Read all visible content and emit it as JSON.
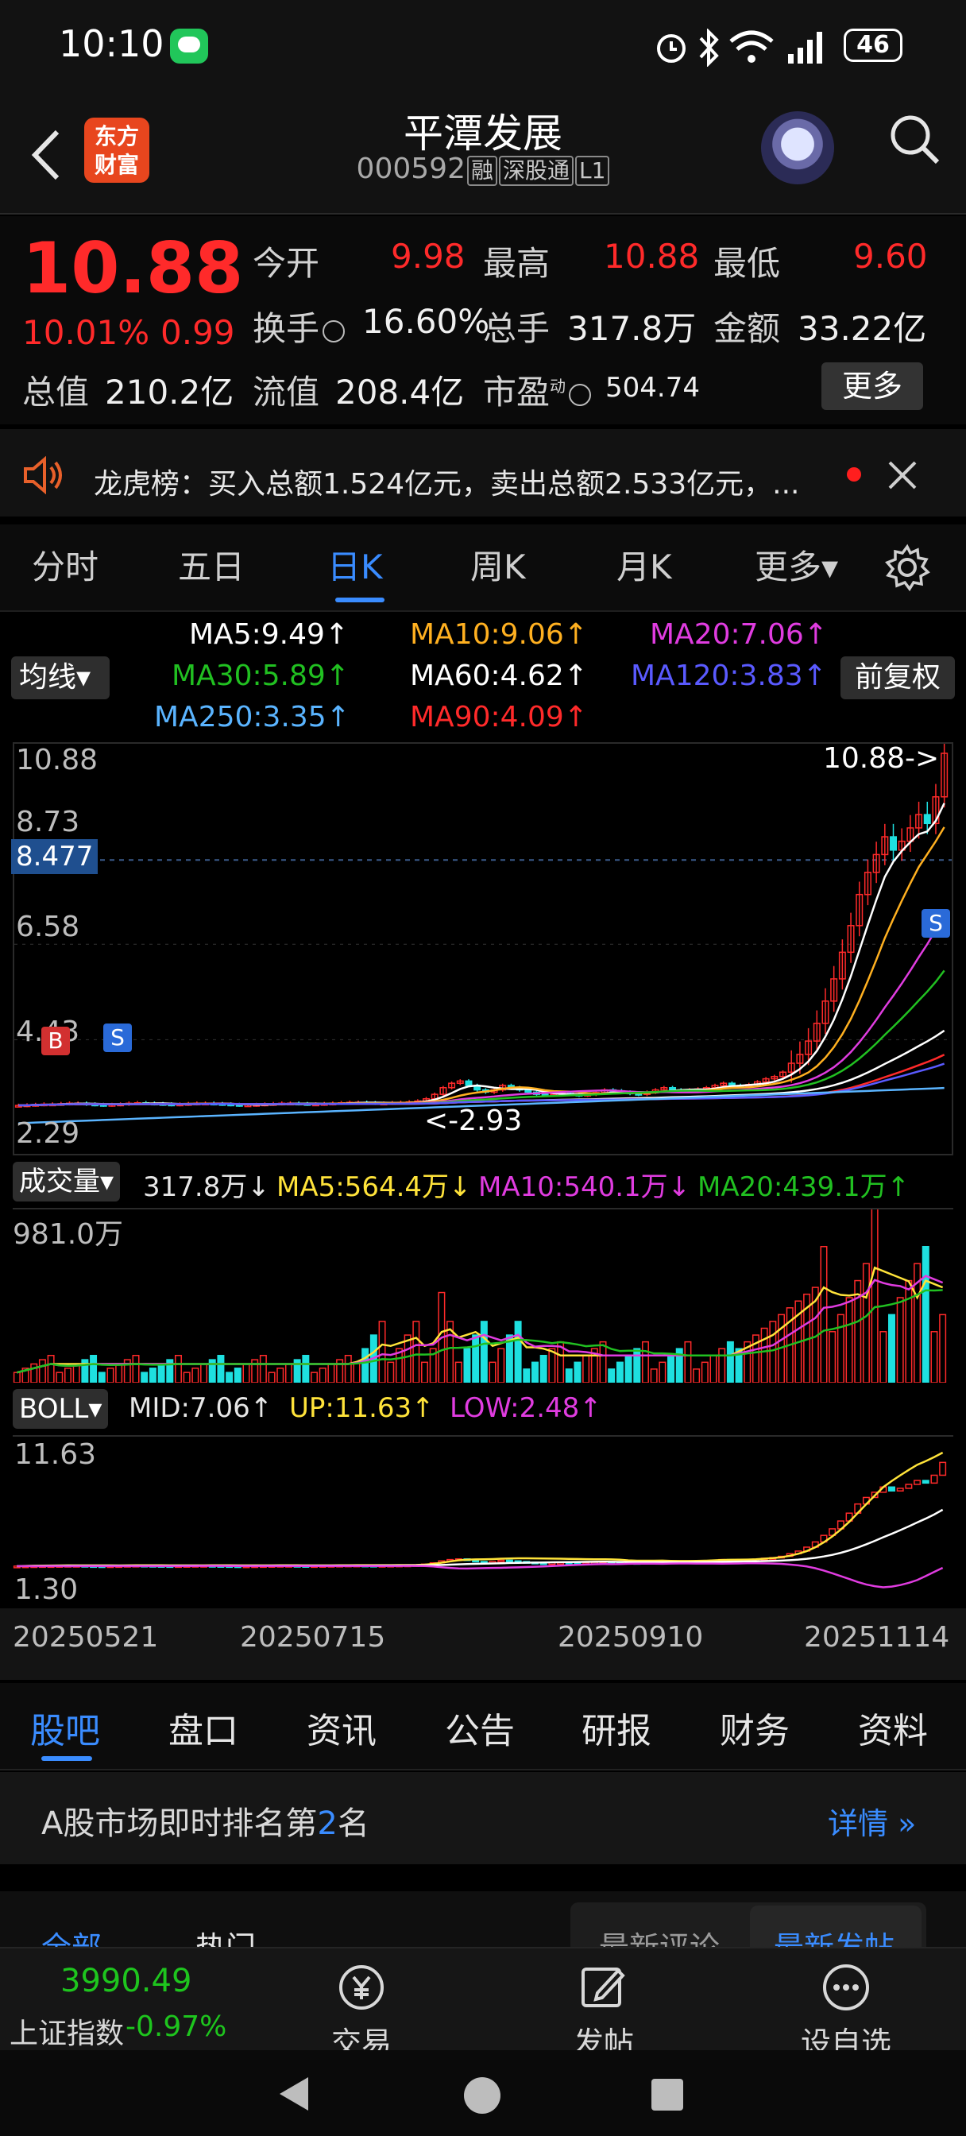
{
  "status_bar": {
    "time": "10:10",
    "battery": "46"
  },
  "header": {
    "logo_line1": "东方",
    "logo_line2": "财富",
    "stock_name": "平潭发展",
    "stock_code": "000592",
    "tags": [
      "融",
      "深股通",
      "L1"
    ]
  },
  "quote": {
    "price": "10.88",
    "change_pct": "10.01%",
    "change_abs": "0.99",
    "open_label": "今开",
    "open": "9.98",
    "high_label": "最高",
    "high": "10.88",
    "low_label": "最低",
    "low": "9.60",
    "turnover_label": "换手",
    "turnover": "16.60%",
    "volume_label": "总手",
    "volume": "317.8万",
    "amount_label": "金额",
    "amount": "33.22亿",
    "mktcap_label": "总值",
    "mktcap": "210.2亿",
    "float_label": "流值",
    "float": "208.4亿",
    "pe_label": "市盈",
    "pe_sup": "动",
    "pe": "504.74",
    "more_label": "更多"
  },
  "dragon": {
    "text": "龙虎榜：买入总额1.524亿元，卖出总额2.533亿元，..."
  },
  "period_tabs": [
    "分时",
    "五日",
    "日K",
    "周K",
    "月K",
    "更多▾"
  ],
  "ma_legend": {
    "selector": "均线▾",
    "fq": "前复权",
    "items": [
      {
        "text": "MA5:9.49↑",
        "color": "#ffffff"
      },
      {
        "text": "MA10:9.06↑",
        "color": "#ffb020"
      },
      {
        "text": "MA20:7.06↑",
        "color": "#e03ce0"
      },
      {
        "text": "MA30:5.89↑",
        "color": "#21c021"
      },
      {
        "text": "MA60:4.62↑",
        "color": "#ffffff"
      },
      {
        "text": "MA120:3.83↑",
        "color": "#5a5aff"
      },
      {
        "text": "MA250:3.35↑",
        "color": "#5ab4ff"
      },
      {
        "text": "MA90:4.09↑",
        "color": "#ff2a2a"
      }
    ]
  },
  "kline": {
    "y_ticks": [
      "10.88",
      "8.73",
      "6.58",
      "4.43",
      "2.29"
    ],
    "cursor_label": "8.477",
    "last_price_label": "10.88->",
    "low_marker": "<-2.93",
    "buy_marker": "B",
    "sell_marker": "S"
  },
  "volume": {
    "selector": "成交量▾",
    "current": "317.8万↓",
    "ma5": "MA5:564.4万↓",
    "ma10": "MA10:540.1万↓",
    "ma20": "MA20:439.1万↑",
    "max_label": "981.0万"
  },
  "boll": {
    "selector": "BOLL▾",
    "mid": "MID:7.06↑",
    "up": "UP:11.63↑",
    "low": "LOW:2.48↑",
    "top_label": "11.63",
    "bottom_label": "1.30"
  },
  "x_axis": [
    "20250521",
    "20250715",
    "20250910",
    "20251114"
  ],
  "chart_data": {
    "type": "candlestick",
    "title": "平潭发展 000592 日K",
    "x_ticks": [
      "20250521",
      "20250715",
      "20250910",
      "20251114"
    ],
    "ylim": [
      2.29,
      10.88
    ],
    "y_ticks": [
      10.88,
      8.73,
      6.58,
      4.43,
      2.29
    ],
    "close": [
      2.95,
      2.96,
      2.97,
      2.98,
      2.98,
      2.99,
      3.0,
      3.0,
      2.98,
      2.97,
      2.96,
      2.97,
      2.98,
      3.0,
      3.01,
      3.0,
      2.99,
      2.98,
      2.97,
      2.98,
      2.99,
      3.0,
      3.0,
      2.99,
      2.98,
      2.97,
      2.96,
      2.96,
      2.97,
      2.98,
      2.99,
      3.0,
      3.0,
      2.99,
      2.98,
      2.98,
      2.99,
      3.0,
      3.01,
      3.02,
      3.02,
      3.01,
      3.0,
      3.0,
      3.01,
      3.02,
      3.03,
      3.05,
      3.1,
      3.2,
      3.35,
      3.45,
      3.5,
      3.4,
      3.3,
      3.25,
      3.3,
      3.4,
      3.35,
      3.3,
      3.25,
      3.2,
      3.18,
      3.2,
      3.22,
      3.2,
      3.18,
      3.2,
      3.24,
      3.3,
      3.28,
      3.25,
      3.22,
      3.2,
      3.25,
      3.3,
      3.35,
      3.3,
      3.28,
      3.3,
      3.32,
      3.35,
      3.4,
      3.45,
      3.4,
      3.38,
      3.42,
      3.48,
      3.55,
      3.6,
      3.7,
      3.9,
      4.1,
      4.4,
      4.8,
      5.3,
      5.8,
      6.4,
      7.0,
      7.7,
      8.2,
      8.6,
      9.0,
      8.7,
      8.9,
      9.2,
      9.5,
      9.3,
      9.9,
      10.88
    ],
    "ma5_last": 9.49,
    "ma10_last": 9.06,
    "ma20_last": 7.06,
    "ma30_last": 5.89,
    "ma60_last": 4.62,
    "ma90_last": 4.09,
    "ma120_last": 3.83,
    "ma250_last": 3.35,
    "volume_max": "981.0万",
    "boll": {
      "mid": 7.06,
      "up": 11.63,
      "low": 2.48,
      "range": [
        1.3,
        11.63
      ]
    }
  },
  "info_tabs": [
    "股吧",
    "盘口",
    "资讯",
    "公告",
    "研报",
    "财务",
    "资料"
  ],
  "rank": {
    "prefix": "A股市场即时排名第",
    "num": "2",
    "suffix": "名",
    "detail": "详情 »"
  },
  "subtabs": {
    "all": "全部",
    "hot": "热门",
    "latest_comment": "最新评论",
    "latest_post": "最新发帖"
  },
  "bottom_bar": {
    "index_value": "3990.49",
    "index_name": "上证指数",
    "index_change": "-0.97%",
    "trade": "交易",
    "post": "发帖",
    "watch": "设自选"
  }
}
